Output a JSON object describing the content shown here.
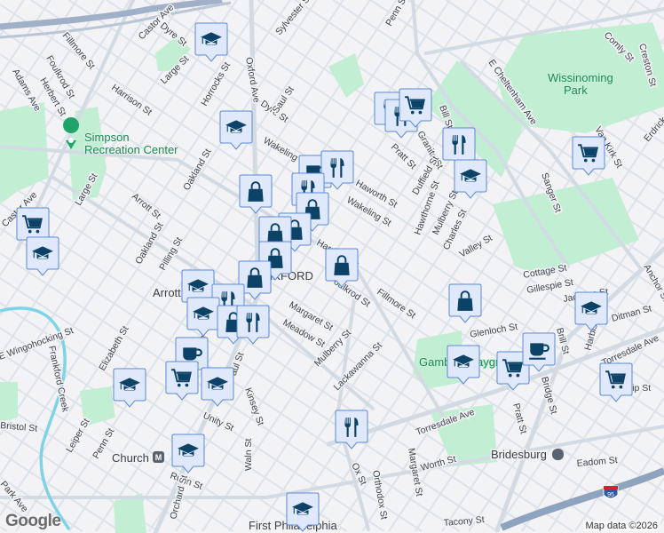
{
  "map": {
    "attribution": "Map data ©2026",
    "logo": "Google",
    "colors": {
      "background": "#f3f2f4",
      "road": "#d5dde5",
      "park": "#c2efd3",
      "marker_fill": "#e0e9fb",
      "marker_border": "#5a8ad8",
      "icon": "#0c4266",
      "water": "#7fd3e8",
      "freeway": "#90a4bf"
    },
    "places": [
      {
        "name": "Simpson Recreation Center",
        "icon": "park-pin-icon"
      },
      {
        "name": "Wissinoming Park"
      },
      {
        "name": "Church",
        "icon": "metro-icon"
      },
      {
        "name": "Bridesburg",
        "icon": "train-icon"
      },
      {
        "name": "Arrott"
      },
      {
        "name": "FRANKFORD"
      },
      {
        "name": "Gambrel Playground"
      },
      {
        "name": "First Philadelphia"
      }
    ],
    "streets": [
      "Dyre St",
      "Castor Ave",
      "Sylvester St",
      "Penn St",
      "Oxford Ave",
      "Fillmore St",
      "Foulkrod St",
      "Harrison St",
      "Large St",
      "Horrocks St",
      "Adams Ave",
      "Herbert St",
      "Dyre St",
      "Saul St",
      "Wakeling St",
      "Oakland St",
      "Arrott St",
      "Large St",
      "Oakland St",
      "Pilling St",
      "Castor Ave",
      "E Cheltenham Ave",
      "Comly St",
      "Creston St",
      "Bill St",
      "Pratt St",
      "Granite St",
      "Haworth St",
      "Wakeling St",
      "Duffield St",
      "Hawthorne St",
      "Mulberry St",
      "Charles St",
      "Valley St",
      "Sanger St",
      "Van Kirk St",
      "Harrison St",
      "Fillmore St",
      "Foulkrod St",
      "Margaret St",
      "Meadow St",
      "Mulberry St",
      "Cottage St",
      "Gillespie St",
      "Jackson St",
      "Glenloch St",
      "Ditman St",
      "Harbison Ave",
      "Torresdale Ave",
      "Torresdale Ave",
      "Lackawanna St",
      "Pratt St",
      "Bridge St",
      "Brill St",
      "Worth St",
      "Eadom St",
      "Margaret St",
      "Orthodox St",
      "Tacony St",
      "E Wingohocking St",
      "Frankford Creek",
      "Elizabeth St",
      "Frankford Ave",
      "Paul St",
      "Kinsey St",
      "Unity St",
      "Bristol St",
      "Leiper St",
      "Penn St",
      "Ruan St",
      "Orchard St",
      "Waln St",
      "Park Ave",
      "Anchor St",
      "Tulip St",
      "Erdrick St",
      "Ox St"
    ],
    "markers": [
      "school",
      "school",
      "cart",
      "school",
      "restaurant",
      "restaurant",
      "cart",
      "restaurant",
      "school",
      "cart",
      "cup",
      "restaurant",
      "restaurant",
      "bag",
      "bag",
      "bag",
      "bag",
      "bag",
      "bag",
      "bag",
      "school",
      "restaurant",
      "school",
      "bag",
      "restaurant",
      "cup",
      "cart",
      "school",
      "school",
      "school",
      "school",
      "bag",
      "school",
      "school",
      "cart",
      "cup",
      "cart",
      "restaurant",
      "bag"
    ],
    "interstate": "95"
  }
}
